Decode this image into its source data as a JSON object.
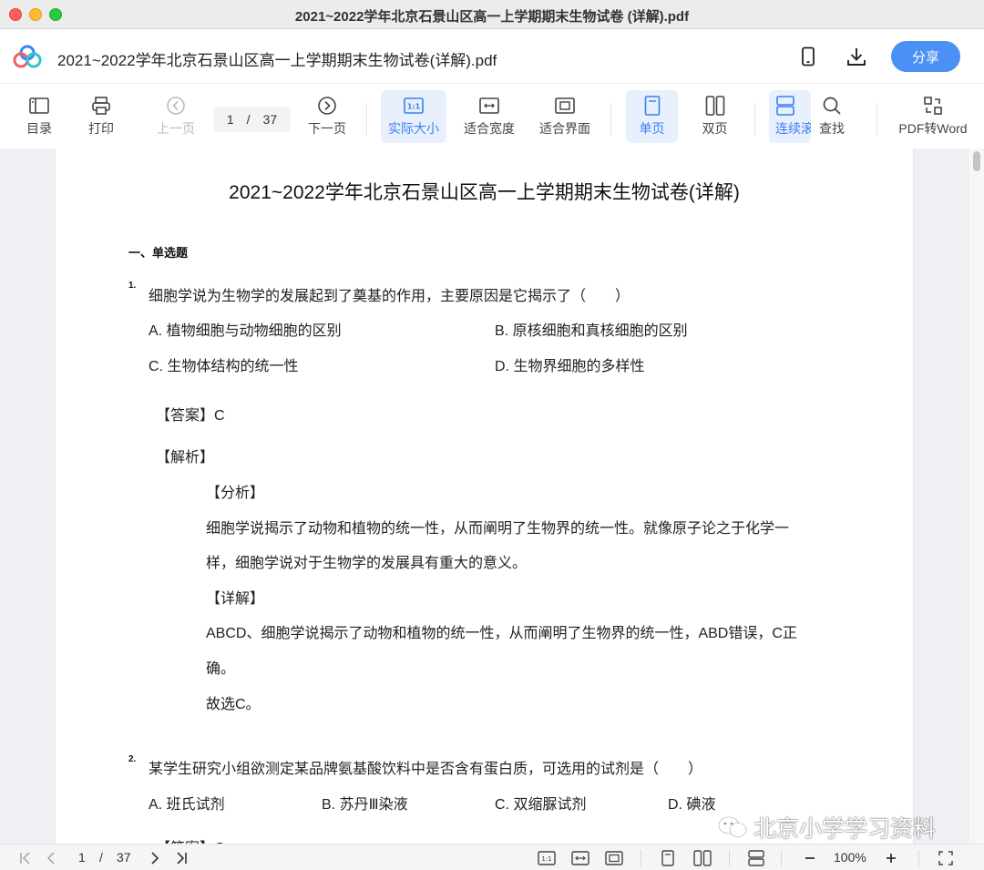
{
  "window": {
    "title": "2021~2022学年北京石景山区高一上学期期末生物试卷 (详解).pdf"
  },
  "header": {
    "doc_name": "2021~2022学年北京石景山区高一上学期期末生物试卷(详解).pdf",
    "share_label": "分享",
    "icons": [
      "app-logo-icon",
      "phone-icon",
      "download-icon"
    ]
  },
  "toolbar": {
    "toc": "目录",
    "print": "打印",
    "prev": "上一页",
    "page_current": "1",
    "page_sep": "/",
    "page_total": "37",
    "next": "下一页",
    "actual_size": "实际大小",
    "fit_width": "适合宽度",
    "fit_page": "适合界面",
    "single": "单页",
    "double": "双页",
    "continuous": "连续滚",
    "find": "查找",
    "pdf_to_word": "PDF转Word"
  },
  "document": {
    "title": "2021~2022学年北京石景山区高一上学期期末生物试卷(详解)",
    "section": "一、单选题",
    "q1": {
      "num": "1.",
      "text": "细胞学说为生物学的发展起到了奠基的作用，主要原因是它揭示了（　　）",
      "options": [
        "A. 植物细胞与动物细胞的区别",
        "B. 原核细胞和真核细胞的区别",
        "C. 生物体结构的统一性",
        "D. 生物界细胞的多样性"
      ],
      "answer": "【答案】C",
      "analysis_head": "【解析】",
      "fenxi_head": "【分析】",
      "fenxi_line1": "细胞学说揭示了动物和植物的统一性，从而阐明了生物界的统一性。就像原子论之于化学一",
      "fenxi_line2": "样，细胞学说对于生物学的发展具有重大的意义。",
      "xiangjie_head": "【详解】",
      "xiangjie_line1": "ABCD、细胞学说揭示了动物和植物的统一性，从而阐明了生物界的统一性，ABD错误，C正",
      "xiangjie_line2": "确。",
      "conclusion": "故选C。"
    },
    "q2": {
      "num": "2.",
      "text": "某学生研究小组欲测定某品牌氨基酸饮料中是否含有蛋白质，可选用的试剂是（　　）",
      "options": [
        "A. 班氏试剂",
        "B. 苏丹Ⅲ染液",
        "C. 双缩脲试剂",
        "D. 碘液"
      ],
      "answer_partial": "【答案】C"
    }
  },
  "watermark": "北京小学学习资料",
  "statusbar": {
    "page_current": "1",
    "page_sep": "/",
    "page_total": "37",
    "zoom": "100%"
  },
  "colors": {
    "accent": "#4a90f5",
    "active_bg": "#e8f0fd",
    "active_text": "#3a7ff2"
  }
}
